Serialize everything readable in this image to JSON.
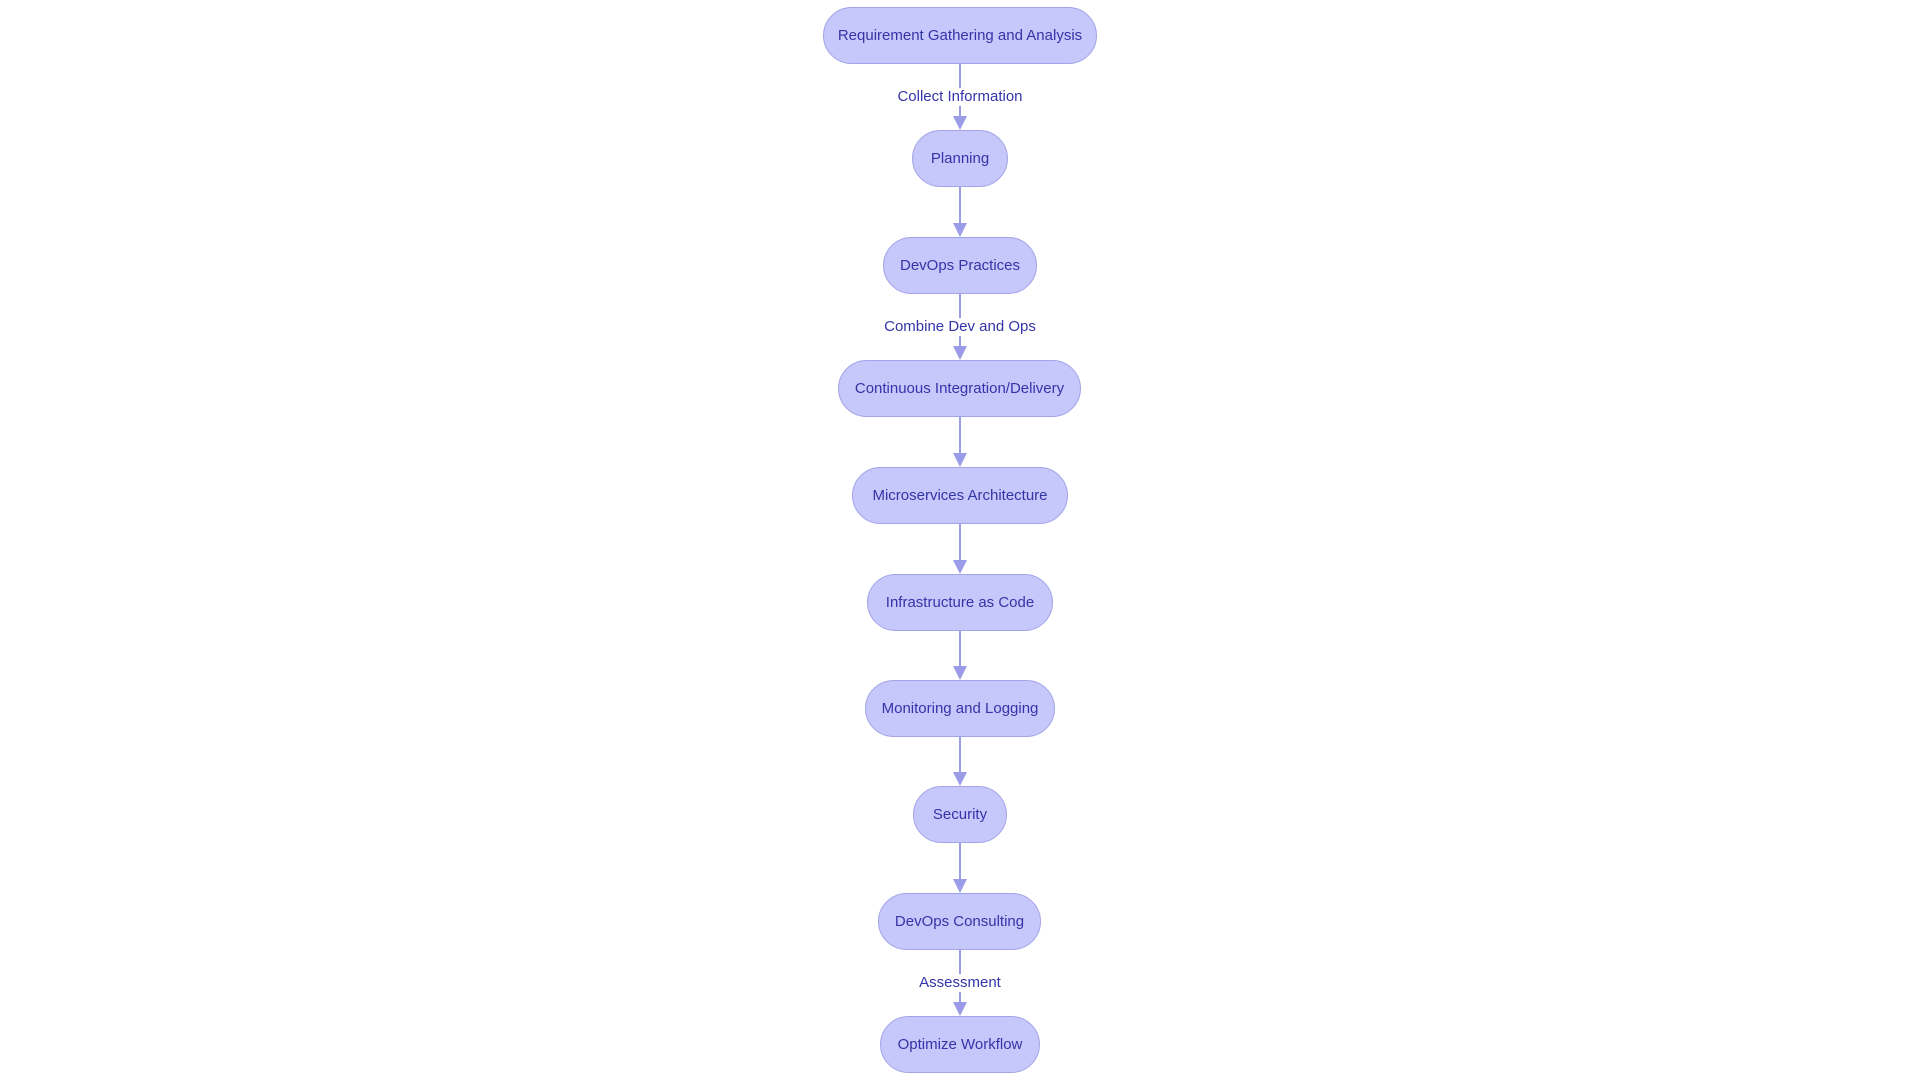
{
  "diagram": {
    "type": "flowchart",
    "direction": "top-to-bottom",
    "colors": {
      "node_fill": "#c6c7fa",
      "node_stroke": "#a3a4e8",
      "text": "#3434a8",
      "edge": "#9b9ce8"
    },
    "nodes": [
      {
        "id": "n0",
        "label": "Requirement Gathering and Analysis"
      },
      {
        "id": "n1",
        "label": "Planning"
      },
      {
        "id": "n2",
        "label": "DevOps Practices"
      },
      {
        "id": "n3",
        "label": "Continuous Integration/Delivery"
      },
      {
        "id": "n4",
        "label": "Microservices Architecture"
      },
      {
        "id": "n5",
        "label": "Infrastructure as Code"
      },
      {
        "id": "n6",
        "label": "Monitoring and Logging"
      },
      {
        "id": "n7",
        "label": "Security"
      },
      {
        "id": "n8",
        "label": "DevOps Consulting"
      },
      {
        "id": "n9",
        "label": "Optimize Workflow"
      }
    ],
    "edges": [
      {
        "from": "n0",
        "to": "n1",
        "label": "Collect Information"
      },
      {
        "from": "n1",
        "to": "n2",
        "label": ""
      },
      {
        "from": "n2",
        "to": "n3",
        "label": "Combine Dev and Ops"
      },
      {
        "from": "n3",
        "to": "n4",
        "label": ""
      },
      {
        "from": "n4",
        "to": "n5",
        "label": ""
      },
      {
        "from": "n5",
        "to": "n6",
        "label": ""
      },
      {
        "from": "n6",
        "to": "n7",
        "label": ""
      },
      {
        "from": "n7",
        "to": "n8",
        "label": ""
      },
      {
        "from": "n8",
        "to": "n9",
        "label": "Assessment"
      }
    ]
  }
}
